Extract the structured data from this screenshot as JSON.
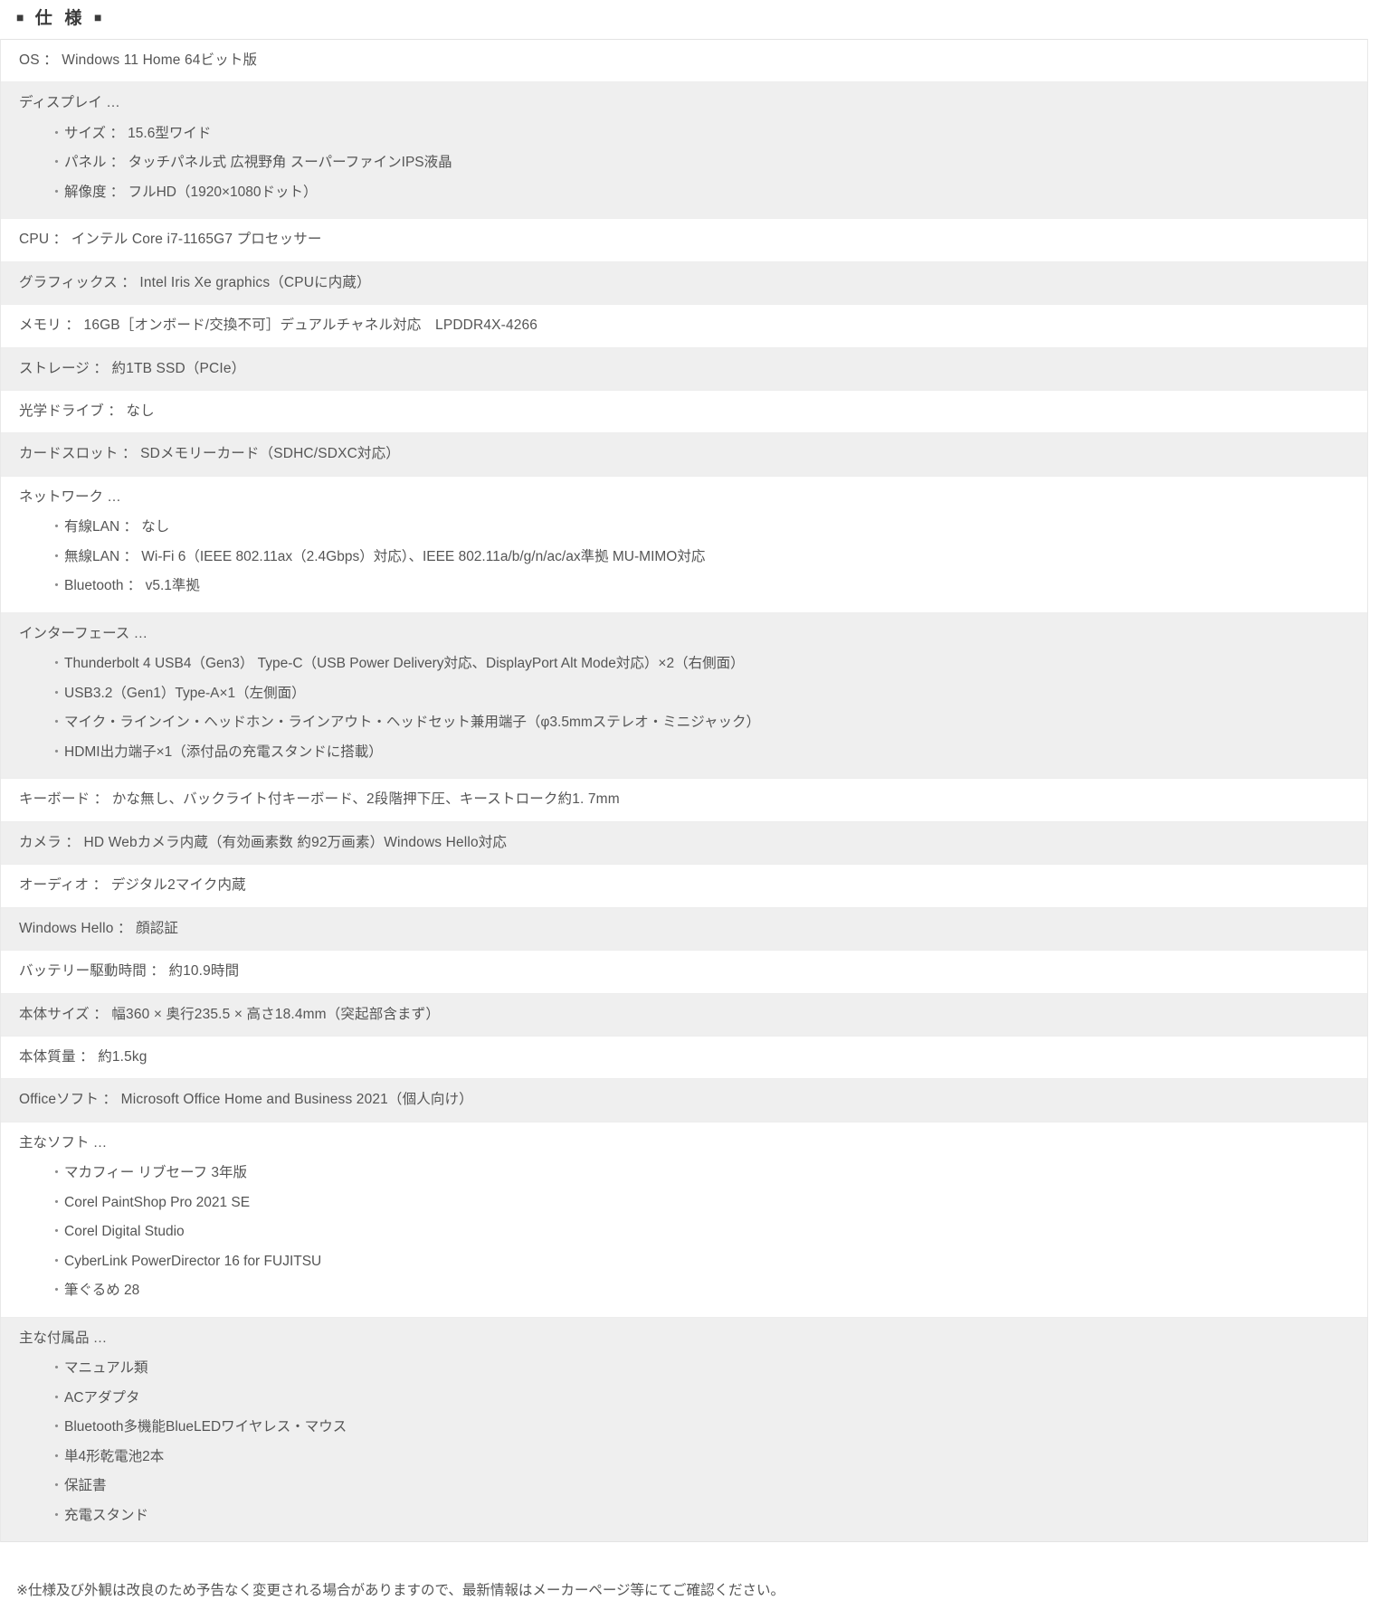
{
  "header": {
    "marker_left": "■",
    "marker_right": "■",
    "title": "仕  様"
  },
  "spec_rows": [
    {
      "kind": "single",
      "name": "os",
      "text": "OS ： Windows 11 Home 64ビット版"
    },
    {
      "kind": "group",
      "name": "display",
      "title": "ディスプレイ …",
      "items": [
        "サイズ ： 15.6型ワイド",
        "パネル ： タッチパネル式 広視野角 スーパーファインIPS液晶",
        "解像度 ： フルHD（1920×1080ドット）"
      ]
    },
    {
      "kind": "single",
      "name": "cpu",
      "text": "CPU ： インテル Core i7-1165G7 プロセッサー"
    },
    {
      "kind": "single",
      "name": "graphics",
      "text": "グラフィックス ： Intel Iris Xe graphics（CPUに内蔵）"
    },
    {
      "kind": "single",
      "name": "memory",
      "text": "メモリ ： 16GB［オンボード/交換不可］デュアルチャネル対応　LPDDR4X-4266"
    },
    {
      "kind": "single",
      "name": "storage",
      "text": "ストレージ ： 約1TB SSD（PCIe）"
    },
    {
      "kind": "single",
      "name": "optical-drive",
      "text": "光学ドライブ ： なし"
    },
    {
      "kind": "single",
      "name": "card-slot",
      "text": "カードスロット ： SDメモリーカード（SDHC/SDXC対応）"
    },
    {
      "kind": "group",
      "name": "network",
      "title": "ネットワーク …",
      "items": [
        "有線LAN ： なし",
        "無線LAN ： Wi-Fi 6（IEEE 802.11ax（2.4Gbps）対応）、IEEE 802.11a/b/g/n/ac/ax準拠 MU-MIMO対応",
        "Bluetooth ： v5.1準拠"
      ]
    },
    {
      "kind": "group",
      "name": "interface",
      "title": "インターフェース …",
      "items": [
        "Thunderbolt 4 USB4（Gen3） Type-C（USB Power Delivery対応、DisplayPort Alt Mode対応）×2（右側面）",
        "USB3.2（Gen1）Type-A×1（左側面）",
        "マイク・ラインイン・ヘッドホン・ラインアウト・ヘッドセット兼用端子（φ3.5mmステレオ・ミニジャック）",
        "HDMI出力端子×1（添付品の充電スタンドに搭載）"
      ]
    },
    {
      "kind": "single",
      "name": "keyboard",
      "text": "キーボード ： かな無し、バックライト付キーボード、2段階押下圧、キーストローク約1. 7mm"
    },
    {
      "kind": "single",
      "name": "camera",
      "text": "カメラ ： HD Webカメラ内蔵（有効画素数 約92万画素）Windows Hello対応"
    },
    {
      "kind": "single",
      "name": "audio",
      "text": "オーディオ ： デジタル2マイク内蔵"
    },
    {
      "kind": "single",
      "name": "windows-hello",
      "text": "Windows Hello ： 顔認証"
    },
    {
      "kind": "single",
      "name": "battery-life",
      "text": "バッテリー駆動時間 ： 約10.9時間"
    },
    {
      "kind": "single",
      "name": "body-size",
      "text": "本体サイズ ： 幅360 × 奥行235.5 × 高さ18.4mm（突起部含まず）"
    },
    {
      "kind": "single",
      "name": "body-weight",
      "text": "本体質量 ： 約1.5kg"
    },
    {
      "kind": "single",
      "name": "office-software",
      "text": "Officeソフト ： Microsoft Office Home and Business 2021（個人向け）"
    },
    {
      "kind": "group",
      "name": "main-software",
      "title": "主なソフト …",
      "items": [
        "マカフィー リブセーフ 3年版",
        "Corel PaintShop Pro 2021 SE",
        "Corel Digital Studio",
        "CyberLink PowerDirector 16 for FUJITSU",
        "筆ぐるめ 28"
      ]
    },
    {
      "kind": "group",
      "name": "accessories",
      "title": "主な付属品 …",
      "items": [
        "マニュアル類",
        "ACアダプタ",
        "Bluetooth多機能BlueLEDワイヤレス・マウス",
        "単4形乾電池2本",
        "保証書",
        "充電スタンド"
      ]
    }
  ],
  "bullet_glyph": "・",
  "footnote": "※仕様及び外観は改良のため予告なく変更される場合がありますので、最新情報はメーカーページ等にてご確認ください。"
}
